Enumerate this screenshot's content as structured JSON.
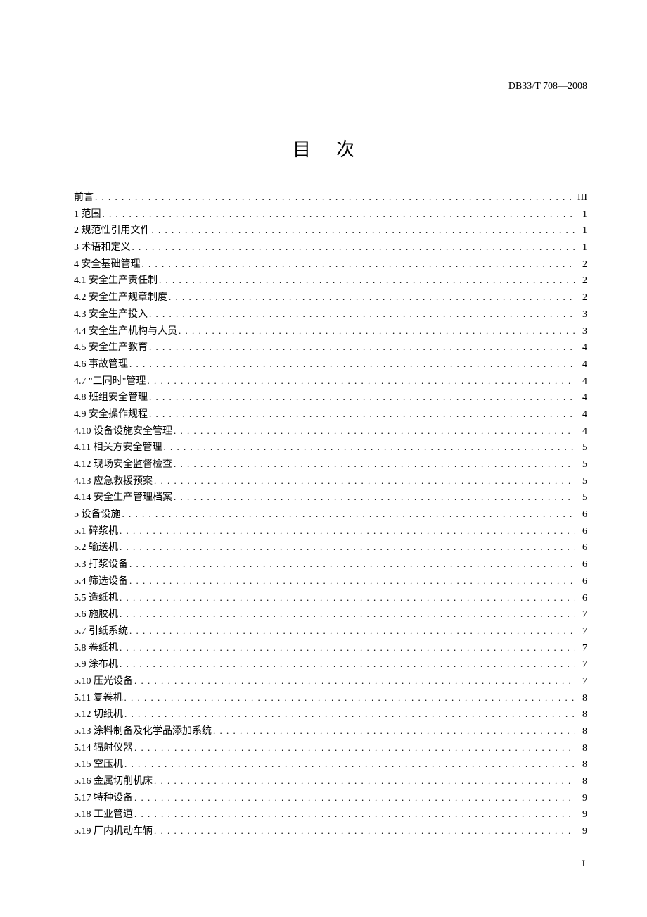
{
  "header": {
    "code": "DB33/T 708—2008"
  },
  "title": "目次",
  "toc": [
    {
      "label": "前言",
      "page": "III"
    },
    {
      "label": "1  范围",
      "page": "1"
    },
    {
      "label": "2  规范性引用文件",
      "page": "1"
    },
    {
      "label": "3  术语和定义",
      "page": "1"
    },
    {
      "label": "4  安全基础管理",
      "page": "2"
    },
    {
      "label": "4.1  安全生产责任制",
      "page": "2"
    },
    {
      "label": "4.2  安全生产规章制度",
      "page": "2"
    },
    {
      "label": "4.3  安全生产投入",
      "page": "3"
    },
    {
      "label": "4.4  安全生产机构与人员",
      "page": "3"
    },
    {
      "label": "4.5  安全生产教育",
      "page": "4"
    },
    {
      "label": "4.6  事故管理",
      "page": "4"
    },
    {
      "label": "4.7  \"三同时\"管理",
      "page": "4"
    },
    {
      "label": "4.8  班组安全管理",
      "page": "4"
    },
    {
      "label": "4.9  安全操作规程",
      "page": "4"
    },
    {
      "label": "4.10  设备设施安全管理",
      "page": "4"
    },
    {
      "label": "4.11  相关方安全管理",
      "page": "5"
    },
    {
      "label": "4.12  现场安全监督检查",
      "page": "5"
    },
    {
      "label": "4.13  应急救援预案",
      "page": "5"
    },
    {
      "label": "4.14  安全生产管理档案",
      "page": "5"
    },
    {
      "label": "5  设备设施",
      "page": "6"
    },
    {
      "label": "5.1  碎浆机",
      "page": "6"
    },
    {
      "label": "5.2  输送机",
      "page": "6"
    },
    {
      "label": "5.3  打浆设备",
      "page": "6"
    },
    {
      "label": "5.4  筛选设备",
      "page": "6"
    },
    {
      "label": "5.5  造纸机",
      "page": "6"
    },
    {
      "label": "5.6  施胶机",
      "page": "7"
    },
    {
      "label": "5.7  引纸系统",
      "page": "7"
    },
    {
      "label": "5.8  卷纸机",
      "page": "7"
    },
    {
      "label": "5.9  涂布机",
      "page": "7"
    },
    {
      "label": "5.10  压光设备",
      "page": "7"
    },
    {
      "label": "5.11  复卷机",
      "page": "8"
    },
    {
      "label": "5.12  切纸机",
      "page": "8"
    },
    {
      "label": "5.13  涂料制备及化学品添加系统",
      "page": "8"
    },
    {
      "label": "5.14  辐射仪器",
      "page": "8"
    },
    {
      "label": "5.15  空压机",
      "page": "8"
    },
    {
      "label": "5.16  金属切削机床",
      "page": "8"
    },
    {
      "label": "5.17  特种设备",
      "page": "9"
    },
    {
      "label": "5.18  工业管道",
      "page": "9"
    },
    {
      "label": "5.19  厂内机动车辆",
      "page": "9"
    }
  ],
  "pageNumber": "I"
}
